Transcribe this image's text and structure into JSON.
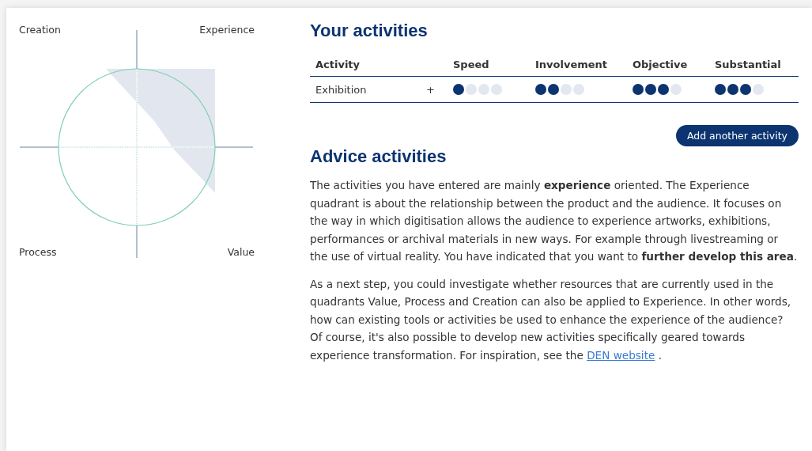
{
  "quadrant_labels": {
    "top_left": "Creation",
    "top_right": "Experience",
    "bottom_left": "Process",
    "bottom_right": "Value"
  },
  "activities": {
    "title": "Your activities",
    "columns": [
      "Activity",
      "",
      "Speed",
      "Involvement",
      "Objective",
      "Substantial"
    ],
    "rows": [
      {
        "name": "Exhibition",
        "toggle": "+",
        "ratings": [
          {
            "stars": 1
          },
          {
            "stars": 2
          },
          {
            "stars": 3
          },
          {
            "stars": 3
          }
        ]
      }
    ],
    "add_button": "Add another activity"
  },
  "advice": {
    "title": "Advice activities",
    "paragraphs": [
      {
        "text": "The activities you have entered are mainly **experience** oriented. The Experience quadrant is about the relationship between the product and the audience. It focuses on the way in which digitisation allows the audience to experience artworks, exhibitions, performances or archival materials in new ways. For example through livestreaming or the use of virtual reality. You have indicated that you want to **further develop this area**."
      },
      {
        "text": "As a next step, you could investigate whether resources that are currently used in the quadrants Value, Process and Creation can also be applied to Experience. In other words, how can existing tools or activities be used to enhance the experience of the audience? Of course, it's also possible to develop new activities specifically geared towards experience transformation. For inspiration, see the ",
        "link": "DEN website",
        "after": " ."
      }
    ]
  }
}
